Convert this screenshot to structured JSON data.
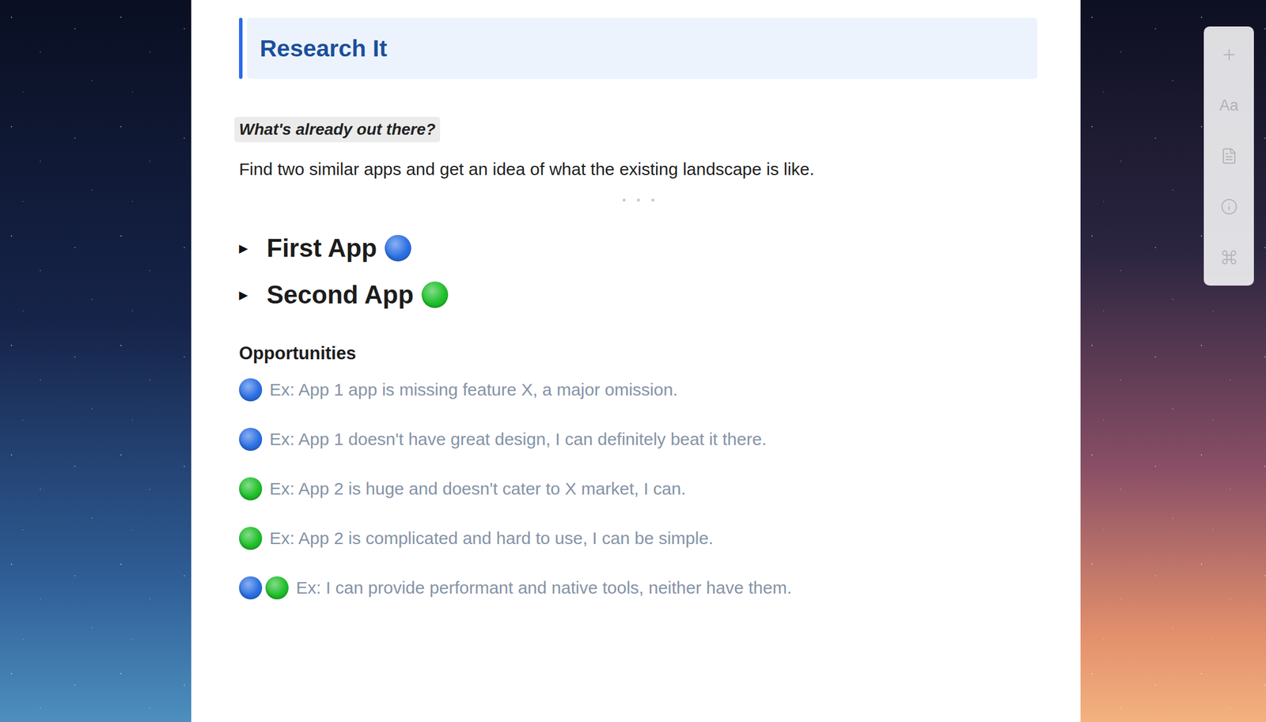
{
  "heading": {
    "title": "Research It"
  },
  "section": {
    "label": "What's already out there?",
    "description": "Find two similar apps and get an idea of what the existing landscape is like."
  },
  "toggles": [
    {
      "toggle": "▶",
      "label": "First App",
      "expanded": false,
      "color": "#2b6fe3"
    },
    {
      "toggle": "▶",
      "label": "Second App",
      "expanded": false,
      "color": "#1fbf2a"
    }
  ],
  "opportunities": {
    "title": "Opportunities",
    "items": [
      {
        "markers": [
          "#2b6fe3"
        ],
        "text": "Ex: App 1 app is missing feature X, a major omission."
      },
      {
        "markers": [
          "#2b6fe3"
        ],
        "text": "Ex: App 1 doesn't have great design, I can definitely beat it there."
      },
      {
        "markers": [
          "#1fbf2a"
        ],
        "text": "Ex: App 2 is huge and doesn't cater to X market, I can."
      },
      {
        "markers": [
          "#1fbf2a"
        ],
        "text": "Ex: App 2 is complicated and hard to use, I can be simple."
      },
      {
        "markers": [
          "#2b6fe3",
          "#1fbf2a"
        ],
        "text": "Ex: I can provide performant and native tools, neither have them."
      }
    ]
  },
  "toolbar": {
    "label": "Aa"
  }
}
